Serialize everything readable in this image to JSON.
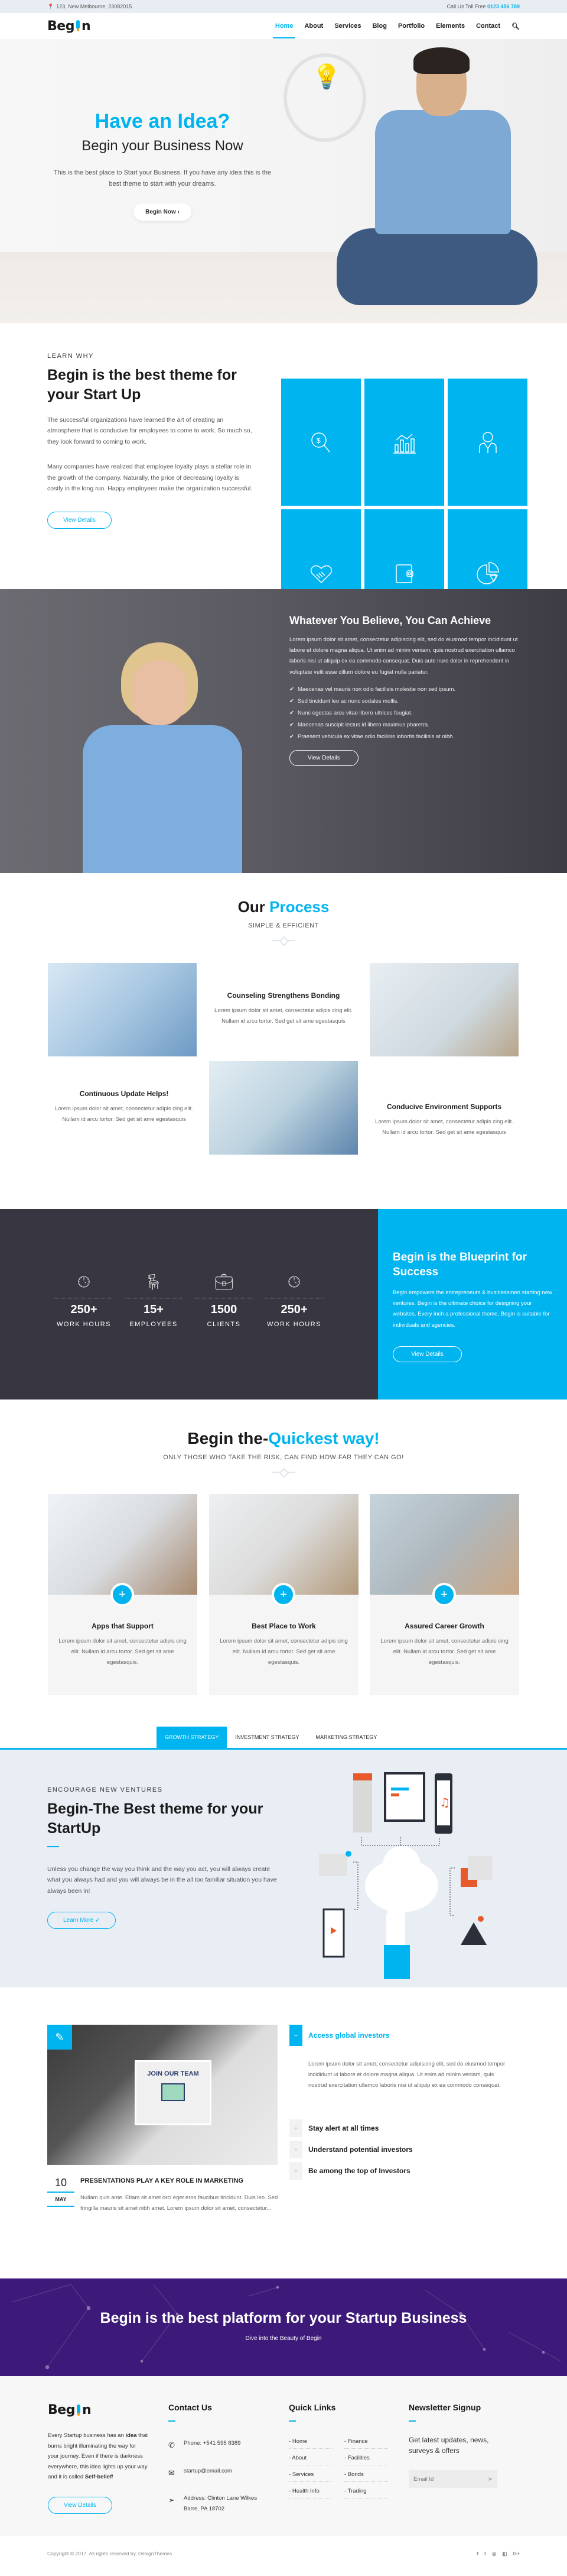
{
  "topbar": {
    "address": "123, New Melbourne, 23082015",
    "call_label": "Call Us Toll Free",
    "phone": "0123 456 789"
  },
  "nav": {
    "logo_prefix": "Beg",
    "logo_suffix": "n",
    "items": [
      "Home",
      "About",
      "Services",
      "Blog",
      "Portfolio",
      "Elements",
      "Contact"
    ],
    "active": "Home"
  },
  "hero": {
    "title": "Have an Idea?",
    "subtitle": "Begin your Business Now",
    "text": "This is the best place to Start your Business. If you have any idea this is the best theme to start with your dreams.",
    "button": "Begin Now ›"
  },
  "learn": {
    "eyebrow": "LEARN WHY",
    "title": "Begin is the best theme for your Start Up",
    "para1": "The successful organizations have learned the art of creating an atmosphere that is conducive for employees to come to work. So much so, they look forward to coming to work.",
    "para2": "Many companies have realized that employee loyalty plays a stellar role in the growth of the company. Naturally, the price of decreasing loyalty is costly in the long run. Happy employees make the organization successful.",
    "button": "View Details",
    "tiles": [
      "dollar-search-icon",
      "bar-chart-icon",
      "businessman-icon",
      "handshake-icon",
      "wallet-icon",
      "pie-chart-icon"
    ]
  },
  "believe": {
    "title": "Whatever You Believe, You Can Achieve",
    "text": "Lorem ipsum dolor sit amet, consectetur adipiscing elit, sed do eiusmod tempor incididunt ut labore et dolore magna aliqua. Ut enim ad minim veniam, quis nostrud exercitation ullamco laboris nisi ut aliquip ex ea commodo consequat. Duis aute irure dolor in reprehenderit in voluptate velit esse cillum dolore eu fugiat nulla pariatur.",
    "checks": [
      "Maecenas vel mauris non odio facilisis molestie non sed ipsum.",
      "Sed tincidunt leo ac nunc sodales mollis.",
      "Nunc egestas arcu vitae libero ultrices feugiat.",
      "Maecenas suscipit lectus id libero maximus pharetra.",
      "Praesent vehicula ex vitae odio facilisis lobortis facilisis at nibh."
    ],
    "button": "View Details"
  },
  "process": {
    "title_a": "Our",
    "title_b": "Process",
    "subtitle": "SIMPLE & EFFICIENT",
    "items": [
      {
        "title": "Counseling Strengthens Bonding",
        "text": "Lorem ipsum dolor sit amet, consectetur adipis cing elit. Nullam id arcu tortor. Sed get sit ame egestasquis"
      },
      {
        "title": "Continuous Update Helps!",
        "text": "Lorem ipsum dolor sit amet, consectetur adipis cing elit. Nullam id arcu tortor. Sed  get sit ame egestasquis"
      },
      {
        "title": "Conducive Environment Supports",
        "text": "Lorem ipsum dolor sit amet, consectetur adipis cing elit. Nullam id arcu tortor. Sed get sit ame egestasquis"
      }
    ]
  },
  "stats": {
    "items": [
      {
        "icon": "clock-icon",
        "value": "250+",
        "label": "WORK HOURS"
      },
      {
        "icon": "office-chair-icon",
        "value": "15+",
        "label": "EMPLOYEES"
      },
      {
        "icon": "briefcase-icon",
        "value": "1500",
        "label": "CLIENTS"
      },
      {
        "icon": "clock-icon",
        "value": "250+",
        "label": "WORK HOURS"
      }
    ],
    "blueprint_title": "Begin is the Blueprint for Success",
    "blueprint_text": "Begin empowers the entrepreneurs & businessmen starting new ventures. Begin is the ultimate choice for designing your websites. Every inch a professional theme, Begin is suitable for individuals and agencies.",
    "button": "View Details"
  },
  "quick": {
    "title_a": "Begin the-",
    "title_b": "Quickest way!",
    "subtitle": "ONLY THOSE WHO TAKE THE RISK, CAN FIND HOW FAR THEY CAN GO!",
    "cards": [
      {
        "title": "Apps that Support",
        "text": "Lorem ipsum dolor sit amet, consectetur adipis cing elit. Nullam id arcu tortor. Sed get sit ame egestasquis."
      },
      {
        "title": "Best Place to Work",
        "text": "Lorem ipsum dolor sit amet, consectetur adipis cing elit. Nullam id arcu tortor. Sed get sit ame egestasquis."
      },
      {
        "title": "Assured Career Growth",
        "text": "Lorem ipsum dolor sit amet, consectetur adipis cing elit. Nullam id arcu tortor. Sed get sit ame egestasquis."
      }
    ]
  },
  "strategy": {
    "tabs": [
      "GROWTH STRATEGY",
      "INVESTMENT STRATEGY",
      "MARKETING STRATEGY"
    ],
    "active": "GROWTH STRATEGY",
    "eyebrow": "ENCOURAGE NEW VENTURES",
    "title": "Begin-The Best theme for your StartUp",
    "text": "Unless you change the way you think and the way you act, you will always create what you always had and you will always be in the all too familiar situation you have always been in!",
    "button": "Learn More"
  },
  "blog": {
    "tablet_text": "JOIN OUR TEAM",
    "day": "10",
    "month": "MAY",
    "post_title": "PRESENTATIONS PLAY A KEY ROLE IN MARKETING",
    "post_text": "Nullam quis ante. Etiam sit amet orci eget eros faucibus tincidunt. Duis leo. Sed fringilla mauris sit amet nibh amet. Lorem ipsum dolor sit amet, consectetur..."
  },
  "accordion": {
    "items": [
      {
        "title": "Access global investors",
        "open": true,
        "body": "Lorem ipsum dolor sit amet, consectetur adipiscing elit, sed do eiusmod tempor incididunt ut labore et dolore magna aliqua. Ut enim ad minim veniam, quis nostrud exercitation ullamco laboris nisi ut aliquip ex ea commodo consequat."
      },
      {
        "title": "Stay alert at all times",
        "open": false
      },
      {
        "title": "Understand potential investors",
        "open": false
      },
      {
        "title": "Be among the top of Investors",
        "open": false
      }
    ]
  },
  "banner": {
    "title": "Begin is the best platform for your Startup Business",
    "subtitle_prefix": "Dive into the Beauty of",
    "subtitle_brand": "Begin"
  },
  "footer": {
    "about_text_1": "Every Startup business has an",
    "about_bold_1": "idea",
    "about_text_2": "that burns bright illuminating the way for your journey. Even if there is darkness everywhere, this idea lights up your way and it is called",
    "about_bold_2": "Self-belief",
    "about_text_3": "!",
    "about_button": "View Details",
    "contact_title": "Contact Us",
    "phone": "Phone: +541 595 8389",
    "email": "startup@email.com",
    "address": "Address: Clinton Lane Wilkes Barre, PA 18702",
    "links_title": "Quick Links",
    "links": [
      "Home",
      "Finance",
      "About",
      "Facilities",
      "Services",
      "Bonds",
      "Health Info",
      "Trading"
    ],
    "news_title": "Newsletter Signup",
    "news_text": "Get latest updates, news, surveys & offers",
    "email_placeholder": "Email Id",
    "copyright": "Copyright © 2017. All rights reserved by, DesignThemes",
    "social": [
      "facebook-icon",
      "twitter-icon",
      "dribbble-icon",
      "delicious-icon",
      "google-plus-icon"
    ]
  }
}
